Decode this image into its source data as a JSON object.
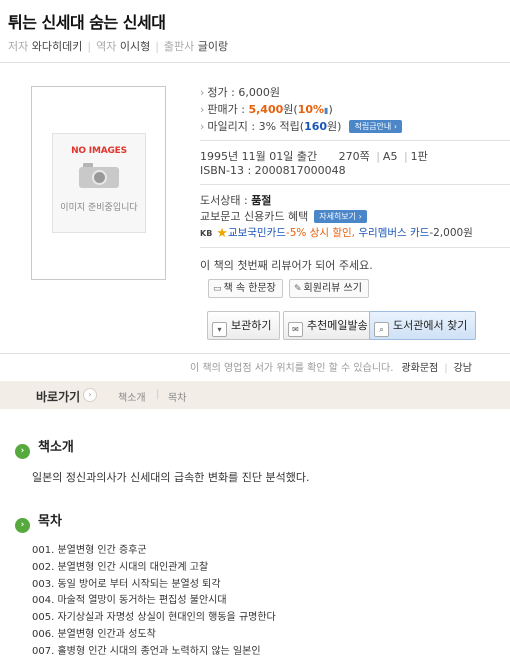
{
  "book": {
    "title": "튀는 신세대 숨는 신세대",
    "author_label": "저자",
    "author": "와다히데키",
    "translator_label": "역자",
    "translator": "이시형",
    "publisher_label": "출판사",
    "publisher": "글이랑"
  },
  "cover": {
    "no_image_text": "NO IMAGES",
    "preparing_text": "이미지 준비중입니다",
    "camera_icon": "camera-icon"
  },
  "price": {
    "list_price_label": "정가 : ",
    "list_price": "6,000원",
    "sale_price_label": "판매가 : ",
    "sale_price": "5,400",
    "sale_price_unit": "원(",
    "discount": "10%",
    "discount_close": ")",
    "mileage_label": "마일리지 : ",
    "mileage_text": "3% 적립(",
    "mileage_points": "160",
    "mileage_unit": "원)",
    "mileage_guide_button": "적립금안내"
  },
  "publication": {
    "date": "1995년 11월 01일 출간",
    "pages": "270쪽",
    "size": "A5",
    "edition": "1판",
    "isbn": "ISBN-13 : 2000817000048"
  },
  "status": {
    "stock_label": "도서상태 : ",
    "stock_value": "품절",
    "card_text": "교보문고 신용카드 혜택",
    "card_detail_button": "자세히보기",
    "kb_label": "KB",
    "kb_card_name": "교보국민카드",
    "kb_discount": "-5% 상시 할인,",
    "kb_member_card": " 우리멤버스 카드",
    "kb_member_discount": "-2,000원"
  },
  "review": {
    "prompt": "이 책의 첫번째 리뷰어가 되어 주세요.",
    "quote_button": "책 속 한문장",
    "member_review_button": "회원리뷰 쓰기"
  },
  "actions": {
    "save_button": "보관하기",
    "recommend_button": "추천메일발송",
    "library_button": "도서관에서 찾기"
  },
  "location": {
    "text": "이 책의 영업점 서가 위치를 확인 할 수 있습니다.",
    "store1": "광화문점",
    "store2": "강남"
  },
  "nav": {
    "title": "바로가기",
    "links": [
      "책소개",
      "목차"
    ]
  },
  "intro": {
    "heading": "책소개",
    "text": "일본의 정신과의사가 신세대의 급속한 변화를 진단 분석했다."
  },
  "toc": {
    "heading": "목차",
    "items": [
      "001. 분열변형 인간 증후군",
      "002. 분열변형 인간 시대의 대인관계 고찰",
      "003. 동일 방어로 부터 시작되는 분열성 퇴각",
      "004. 마술적 열망이 동거하는 편집성 불안시대",
      "005. 자기상실과 자명성 상실이 현대인의 행동을 규명한다",
      "006. 분열변형 인간과 성도착",
      "007. 홀병형 인간 시대의 종언과 노력하지 않는 일본인"
    ]
  }
}
